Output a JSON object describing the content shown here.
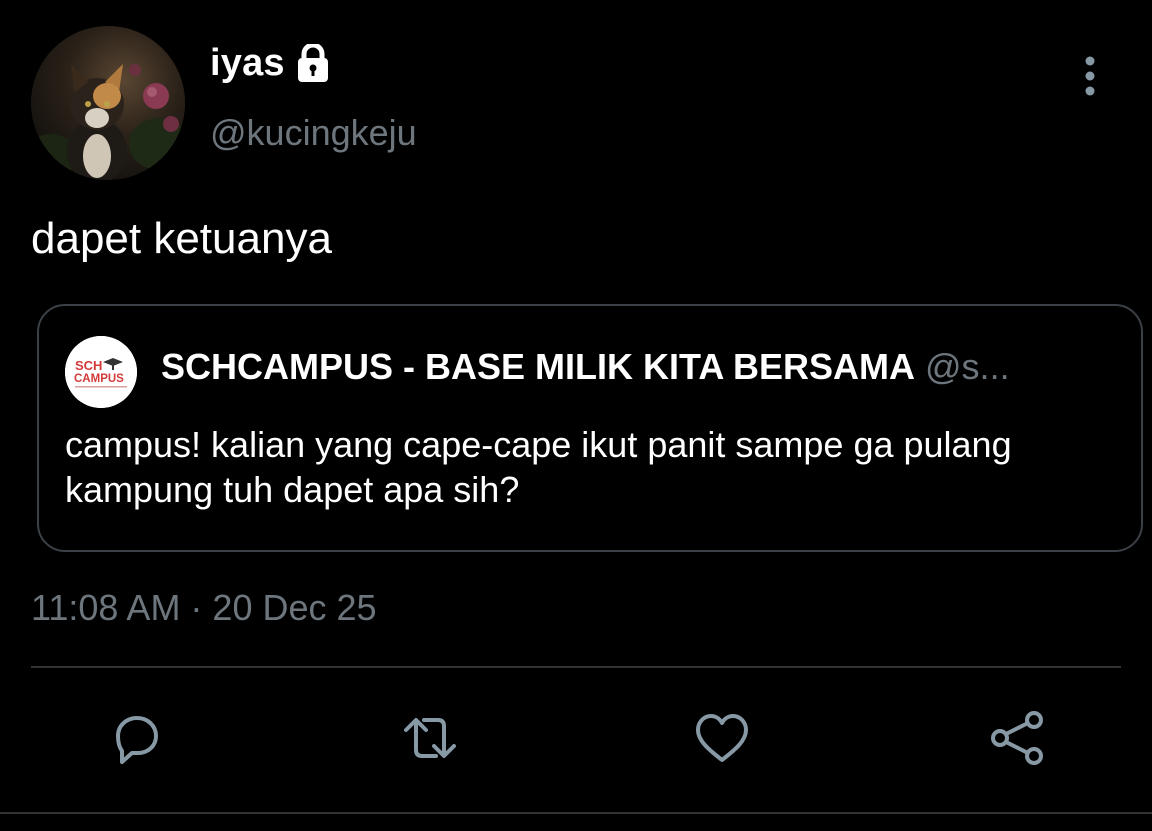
{
  "author": {
    "display_name": "iyas",
    "handle": "@kucingkeju",
    "protected_icon": "lock-icon",
    "avatar": "cat-photo-avatar"
  },
  "tweet": {
    "text": "dapet ketuanya",
    "timestamp": "11:08 AM · 20 Dec 25"
  },
  "quoted_tweet": {
    "avatar_text_top": "SCH",
    "avatar_text_bottom": "CAMPUS",
    "display_name": "SCHCAMPUS - BASE MILIK KITA BERSAMA",
    "handle": "@s...",
    "text": "campus! kalian yang cape-cape ikut panit sampe ga pulang kampung tuh dapet apa sih?"
  },
  "actions": {
    "icons": [
      "reply-icon",
      "retweet-icon",
      "like-icon",
      "share-icon"
    ]
  },
  "menu": {
    "icon": "more-vertical-icon"
  },
  "colors": {
    "background": "#000000",
    "primary_text": "#ffffff",
    "secondary_text": "#6e767d",
    "border": "#3b4046",
    "icon": "#8899a6"
  }
}
